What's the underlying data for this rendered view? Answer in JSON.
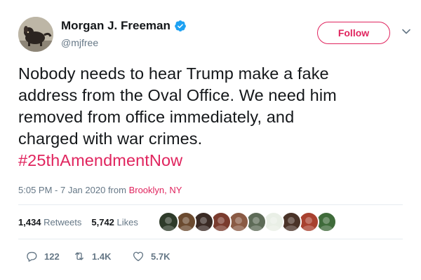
{
  "author": {
    "display_name": "Morgan J. Freeman",
    "handle": "@mjfree",
    "verified": true,
    "avatar_icon": "dog-photo-avatar"
  },
  "follow_label": "Follow",
  "menu_icon": "chevron-down-icon",
  "tweet": {
    "lines": [
      "Nobody needs to hear Trump make a fake",
      "address from the Oval Office. We need him",
      "removed from office immediately, and",
      "charged with war crimes."
    ],
    "hashtag": "#25thAmendmentNow"
  },
  "meta": {
    "time": "5:05 PM",
    "separator": " - ",
    "date": "7 Jan 2020",
    "from_label": " from ",
    "location": "Brooklyn, NY"
  },
  "stats": {
    "retweets_count": "1,434",
    "retweets_label": "Retweets",
    "likes_count": "5,742",
    "likes_label": "Likes"
  },
  "likers": [
    {
      "icon": "liker-avatar-1",
      "color": "#2e3b2a"
    },
    {
      "icon": "liker-avatar-2",
      "color": "#6b4a2f"
    },
    {
      "icon": "liker-avatar-3",
      "color": "#3a2a24"
    },
    {
      "icon": "liker-avatar-4",
      "color": "#7a3b2e"
    },
    {
      "icon": "liker-avatar-5",
      "color": "#8a5a44"
    },
    {
      "icon": "liker-avatar-6",
      "color": "#5d6b57"
    },
    {
      "icon": "liker-avatar-7",
      "color": "#e9efe6"
    },
    {
      "icon": "liker-avatar-8",
      "color": "#4a3328"
    },
    {
      "icon": "liker-avatar-9",
      "color": "#a8412f"
    },
    {
      "icon": "liker-avatar-10",
      "color": "#3f6b3a"
    }
  ],
  "actions": {
    "reply_count": "122",
    "retweet_count": "1.4K",
    "like_count": "5.7K"
  },
  "colors": {
    "accent": "#e0245e",
    "verified_blue": "#1da1f2",
    "secondary_text": "#657786",
    "primary_text": "#14171a"
  }
}
